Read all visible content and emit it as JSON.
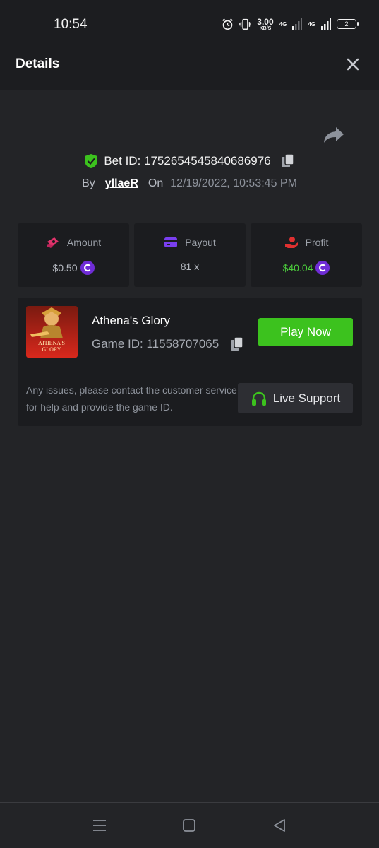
{
  "status_bar": {
    "time": "10:54",
    "speed_value": "3.00",
    "speed_unit": "KB/S",
    "net1": "4G",
    "net2": "4G",
    "battery": "2",
    "icons": [
      "alarm-icon",
      "vibrate-icon",
      "signal-icon",
      "battery-icon"
    ]
  },
  "header": {
    "title": "Details",
    "close_icon": "close-icon"
  },
  "bet": {
    "id_text": "Bet ID: 1752654545840686976",
    "by_label": "By",
    "user": "yllaeR",
    "on_label": "On",
    "date": "12/19/2022, 10:53:45 PM"
  },
  "stats": {
    "amount": {
      "label": "Amount",
      "value": "$0.50"
    },
    "payout": {
      "label": "Payout",
      "value": "81 x"
    },
    "profit": {
      "label": "Profit",
      "value": "$40.04"
    }
  },
  "game": {
    "name": "Athena's Glory",
    "id_text": "Game ID: 11558707065",
    "thumb_text_1": "ATHENA'S",
    "thumb_text_2": "GLORY",
    "play_label": "Play Now",
    "support_text": "Any issues, please contact the customer service for help and provide the game ID.",
    "support_label": "Live Support"
  },
  "colors": {
    "accent_green": "#3cc21e",
    "profit_green": "#4ccf3c",
    "coin_purple": "#6f2cd6",
    "background": "#232427",
    "card": "#1b1c1f"
  }
}
